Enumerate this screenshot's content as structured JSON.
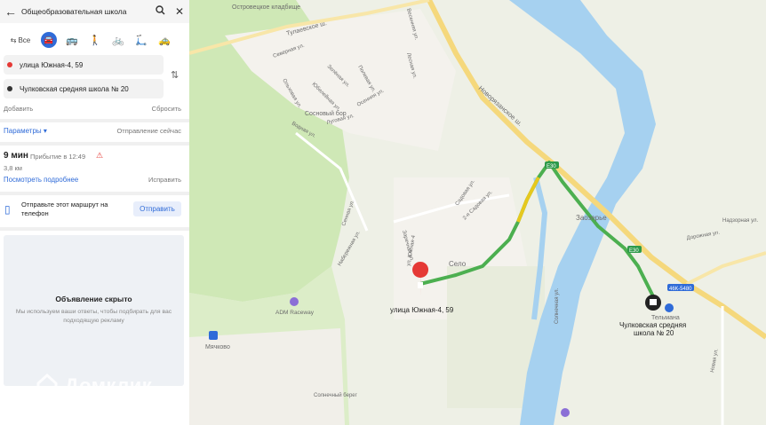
{
  "search": {
    "query": "Общеобразовательная школа"
  },
  "modes": {
    "all_label": "Все"
  },
  "route": {
    "from": "улица Южная-4, 59",
    "to": "Чулковская средняя школа № 20",
    "add": "Добавить",
    "reset": "Сбросить",
    "params": "Параметры",
    "departure": "Отправление сейчас",
    "duration": "9 мин",
    "arrival": "Прибытие в 12:49",
    "distance": "3,8 км",
    "details": "Посмотреть подробнее",
    "fix": "Исправить"
  },
  "send": {
    "text": "Отправьте этот маршрут на телефон",
    "button": "Отправить"
  },
  "ad": {
    "title": "Объявление скрыто",
    "desc": "Мы используем ваши ответы, чтобы подбирать для вас подходящую рекламу"
  },
  "watermark": "Домклик",
  "map": {
    "labels": {
      "cemetery": "Островецкое кладбище",
      "tulaevskoe": "Тулаевское ш.",
      "novoryazanskoe": "Новорязанское ш.",
      "sosnovy_bor": "Сосновый бор",
      "severnaya": "Северная ул.",
      "olhovaya": "Ольховая ул.",
      "zelenaya": "Зелёная ул.",
      "yubileynaya": "Юбилейная ул.",
      "polevaya": "Полевая ул.",
      "lesnaya": "Лесная ул.",
      "osennaya": "Осенняя ул.",
      "lugovaya": "Луговая ул.",
      "vodnaya": "Водная ул.",
      "vesennyaya": "Весенняя ул.",
      "sennaya": "Сенная ул.",
      "naberezhnaya": "Набережная ул.",
      "zarechnaya": "Заречная ул.",
      "yuzhnaya4": "ул. Южная-4",
      "sadovaya": "Садовая ул.",
      "sadovaya2": "2-я Садовая ул.",
      "solnechnaya": "Солнечная ул.",
      "selo": "Село",
      "zaozerye": "Заозерье",
      "dorozhnaya": "Дорожная ул.",
      "nadzor": "Надзорная ул.",
      "navaya": "Новая ул.",
      "raceway": "ADM Raceway",
      "myachkovo": "Мячково",
      "solnechny_bereg": "Солнечный берег",
      "telmana": "Тельмана",
      "start_label": "улица Южная-4, 59",
      "end_label_1": "Чулковская средняя",
      "end_label_2": "школа № 20",
      "e30": "E30",
      "e30b": "E30",
      "mkad": "46К-5480"
    }
  }
}
